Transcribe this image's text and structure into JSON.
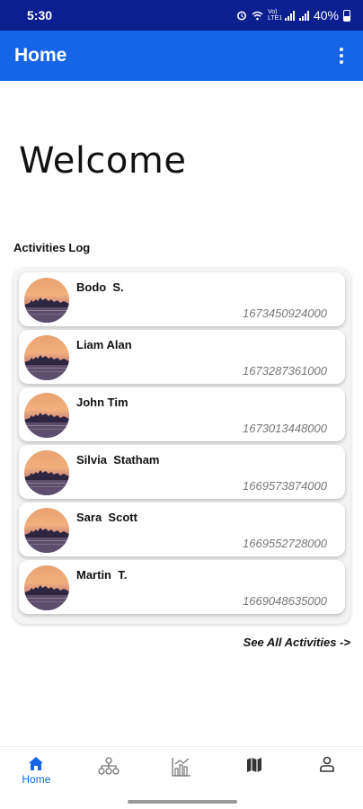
{
  "status_bar": {
    "time": "5:30",
    "network_label": "Vo) LTE1",
    "battery": "40%"
  },
  "app_bar": {
    "title": "Home",
    "more_icon": "more-vertical-icon"
  },
  "welcome": "Welcome",
  "activities": {
    "label": "Activities Log",
    "items": [
      {
        "name": "Bodo  S.",
        "timestamp": "1673450924000"
      },
      {
        "name": "Liam Alan",
        "timestamp": "1673287361000"
      },
      {
        "name": "John Tim",
        "timestamp": "1673013448000"
      },
      {
        "name": "Silvia  Statham",
        "timestamp": "1669573874000"
      },
      {
        "name": "Sara  Scott",
        "timestamp": "1669552728000"
      },
      {
        "name": "Martin  T.",
        "timestamp": "1669048635000"
      }
    ],
    "see_all": "See All Activities ->"
  },
  "bottom_nav": {
    "items": [
      {
        "label": "Home",
        "icon": "home-icon",
        "active": true
      },
      {
        "label": "",
        "icon": "hierarchy-icon",
        "active": false
      },
      {
        "label": "",
        "icon": "chart-icon",
        "active": false
      },
      {
        "label": "",
        "icon": "map-icon",
        "active": false
      },
      {
        "label": "",
        "icon": "profile-icon",
        "active": false
      }
    ]
  },
  "colors": {
    "status_bar": "#0b1f8f",
    "app_bar": "#1565e6",
    "accent": "#1565e6",
    "inactive_icon": "#777777"
  }
}
